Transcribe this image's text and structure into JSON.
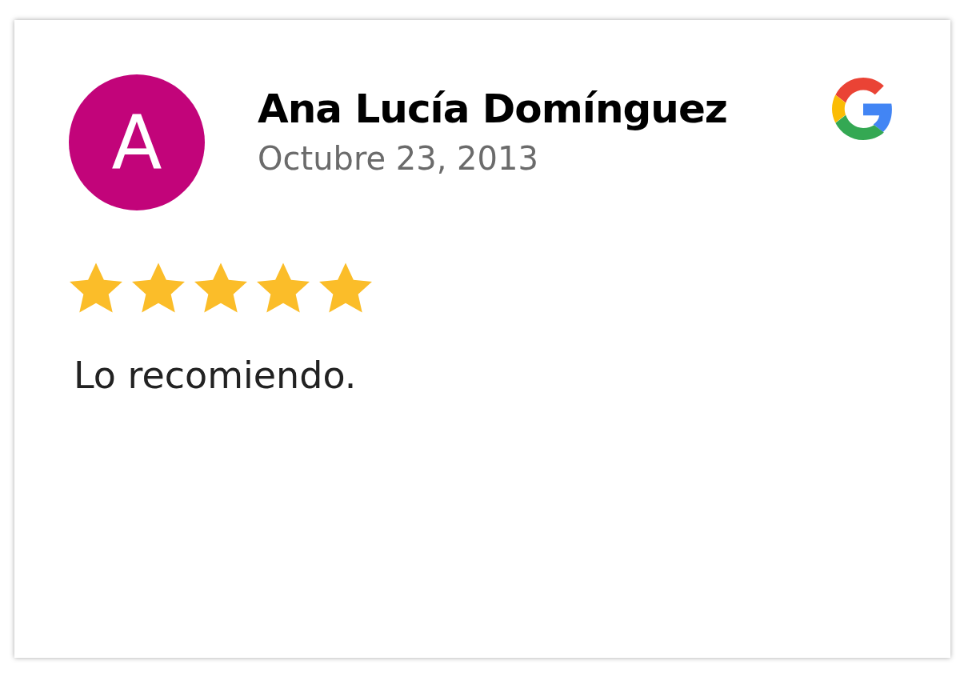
{
  "review": {
    "avatar_initial": "A",
    "name": "Ana Lucía Domínguez",
    "date": "Octubre 23, 2013",
    "stars": 5,
    "text": "Lo recomiendo."
  }
}
